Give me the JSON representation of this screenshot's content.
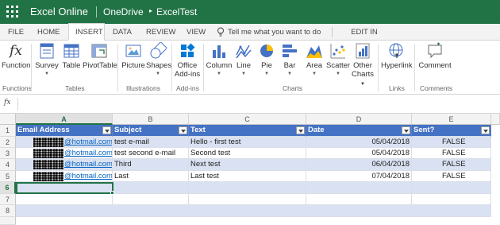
{
  "titlebar": {
    "app_name": "Excel Online",
    "crumb_location": "OneDrive",
    "crumb_arrow": "▸",
    "crumb_file": "ExcelTest"
  },
  "tabs": [
    {
      "label": "FILE",
      "active": false
    },
    {
      "label": "HOME",
      "active": false
    },
    {
      "label": "INSERT",
      "active": true
    },
    {
      "label": "DATA",
      "active": false
    },
    {
      "label": "REVIEW",
      "active": false
    },
    {
      "label": "VIEW",
      "active": false
    }
  ],
  "tell_me": "Tell me what you want to do",
  "edit_in_excel": "EDIT IN EXCEL",
  "ribbon": {
    "function_label": "Function",
    "survey_label": "Survey",
    "table_label": "Table",
    "pivot_label": "PivotTable",
    "picture_label": "Picture",
    "shapes_label": "Shapes",
    "office_label": "Office",
    "addins_label": "Add-ins",
    "column_label": "Column",
    "line_label": "Line",
    "pie_label": "Pie",
    "bar_label": "Bar",
    "area_label": "Area",
    "scatter_label": "Scatter",
    "other_label": "Other",
    "charts_label": "Charts",
    "hyperlink_label": "Hyperlink",
    "comment_label": "Comment",
    "groups": {
      "functions": "Functions",
      "tables": "Tables",
      "illustrations": "Illustrations",
      "addins": "Add-ins",
      "charts": "Charts",
      "links": "Links",
      "comments": "Comments"
    }
  },
  "formula_bar": {
    "fx": "fx",
    "value": ""
  },
  "grid": {
    "columns": [
      "A",
      "B",
      "C",
      "D",
      "E"
    ],
    "rows": [
      "1",
      "2",
      "3",
      "4",
      "5",
      "6",
      "7",
      "8"
    ],
    "headers": [
      "Email Address",
      "Subject",
      "Text",
      "Date",
      "Sent?"
    ],
    "data": [
      {
        "email": "@hotmail.com",
        "subject": "test e-mail",
        "text": "Hello - first test",
        "date": "05/04/2018",
        "sent": "FALSE"
      },
      {
        "email": "@hotmail.com",
        "subject": "test second e-mail",
        "text": "Second test",
        "date": "05/04/2018",
        "sent": "FALSE"
      },
      {
        "email": "@hotmail.com",
        "subject": "Third",
        "text": "Next test",
        "date": "06/04/2018",
        "sent": "FALSE"
      },
      {
        "email": "@hotmail.com",
        "subject": "Last",
        "text": "Last test",
        "date": "07/04/2018",
        "sent": "FALSE"
      }
    ],
    "selected_cell": "A6"
  },
  "colors": {
    "excel_green": "#217346",
    "table_header": "#4472c4",
    "table_band": "#d9e1f2",
    "link": "#0563c1"
  }
}
